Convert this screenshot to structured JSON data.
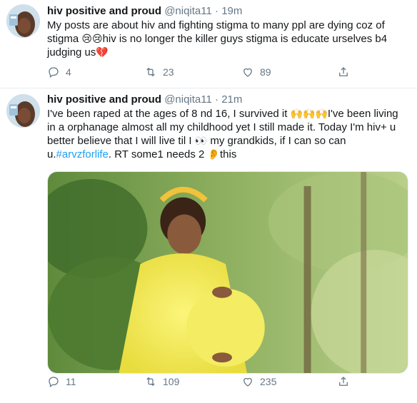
{
  "tweets": [
    {
      "name": "hiv positive and proud",
      "handle": "@niqita11",
      "dot": "·",
      "time": "19m",
      "text_part1": "My posts are about hiv and fighting stigma to many ppl are dying coz of stigma ",
      "emoji1": "😢😢",
      "text_part2": "hiv is no longer the killer guys stigma is educate urselves b4 judging us",
      "emoji2": "💔",
      "replies": "4",
      "retweets": "23",
      "likes": "89"
    },
    {
      "name": "hiv positive and proud",
      "handle": "@niqita11",
      "dot": "·",
      "time": "21m",
      "text_part1": "I've been raped at the ages of 8 nd 16, I survived it ",
      "emoji1": "🙌🙌🙌",
      "text_part2": "I've been living in a orphanage almost all my childhood yet I still made it. Today I'm hiv+ u better believe that I will live til I ",
      "emoji2": "👀",
      "text_part3": " my grandkids, if I can so can u.",
      "hashtag": "#arvzforlife",
      "text_part4": ". RT some1 needs 2 ",
      "emoji3": "👂",
      "text_part5": "this",
      "replies": "11",
      "retweets": "109",
      "likes": "235"
    }
  ],
  "icons": {
    "reply": "reply-icon",
    "retweet": "retweet-icon",
    "like": "heart-icon",
    "share": "share-icon"
  },
  "colors": {
    "text": "#14171a",
    "secondary": "#657786",
    "link": "#1da1f2",
    "divider": "#e6ecf0",
    "dress": "#f2ec5a"
  }
}
